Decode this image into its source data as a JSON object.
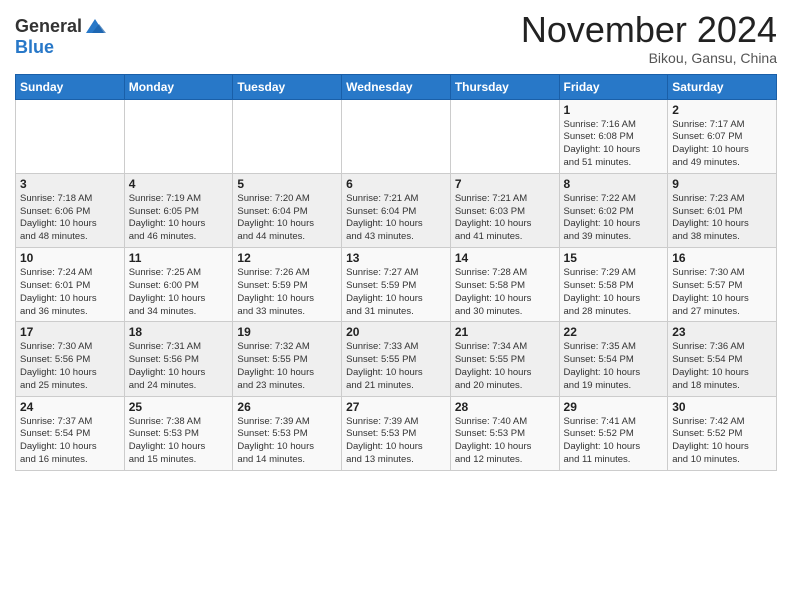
{
  "header": {
    "logo_line1": "General",
    "logo_line2": "Blue",
    "month_title": "November 2024",
    "location": "Bikou, Gansu, China"
  },
  "weekdays": [
    "Sunday",
    "Monday",
    "Tuesday",
    "Wednesday",
    "Thursday",
    "Friday",
    "Saturday"
  ],
  "weeks": [
    [
      {
        "day": "",
        "content": ""
      },
      {
        "day": "",
        "content": ""
      },
      {
        "day": "",
        "content": ""
      },
      {
        "day": "",
        "content": ""
      },
      {
        "day": "",
        "content": ""
      },
      {
        "day": "1",
        "content": "Sunrise: 7:16 AM\nSunset: 6:08 PM\nDaylight: 10 hours\nand 51 minutes."
      },
      {
        "day": "2",
        "content": "Sunrise: 7:17 AM\nSunset: 6:07 PM\nDaylight: 10 hours\nand 49 minutes."
      }
    ],
    [
      {
        "day": "3",
        "content": "Sunrise: 7:18 AM\nSunset: 6:06 PM\nDaylight: 10 hours\nand 48 minutes."
      },
      {
        "day": "4",
        "content": "Sunrise: 7:19 AM\nSunset: 6:05 PM\nDaylight: 10 hours\nand 46 minutes."
      },
      {
        "day": "5",
        "content": "Sunrise: 7:20 AM\nSunset: 6:04 PM\nDaylight: 10 hours\nand 44 minutes."
      },
      {
        "day": "6",
        "content": "Sunrise: 7:21 AM\nSunset: 6:04 PM\nDaylight: 10 hours\nand 43 minutes."
      },
      {
        "day": "7",
        "content": "Sunrise: 7:21 AM\nSunset: 6:03 PM\nDaylight: 10 hours\nand 41 minutes."
      },
      {
        "day": "8",
        "content": "Sunrise: 7:22 AM\nSunset: 6:02 PM\nDaylight: 10 hours\nand 39 minutes."
      },
      {
        "day": "9",
        "content": "Sunrise: 7:23 AM\nSunset: 6:01 PM\nDaylight: 10 hours\nand 38 minutes."
      }
    ],
    [
      {
        "day": "10",
        "content": "Sunrise: 7:24 AM\nSunset: 6:01 PM\nDaylight: 10 hours\nand 36 minutes."
      },
      {
        "day": "11",
        "content": "Sunrise: 7:25 AM\nSunset: 6:00 PM\nDaylight: 10 hours\nand 34 minutes."
      },
      {
        "day": "12",
        "content": "Sunrise: 7:26 AM\nSunset: 5:59 PM\nDaylight: 10 hours\nand 33 minutes."
      },
      {
        "day": "13",
        "content": "Sunrise: 7:27 AM\nSunset: 5:59 PM\nDaylight: 10 hours\nand 31 minutes."
      },
      {
        "day": "14",
        "content": "Sunrise: 7:28 AM\nSunset: 5:58 PM\nDaylight: 10 hours\nand 30 minutes."
      },
      {
        "day": "15",
        "content": "Sunrise: 7:29 AM\nSunset: 5:58 PM\nDaylight: 10 hours\nand 28 minutes."
      },
      {
        "day": "16",
        "content": "Sunrise: 7:30 AM\nSunset: 5:57 PM\nDaylight: 10 hours\nand 27 minutes."
      }
    ],
    [
      {
        "day": "17",
        "content": "Sunrise: 7:30 AM\nSunset: 5:56 PM\nDaylight: 10 hours\nand 25 minutes."
      },
      {
        "day": "18",
        "content": "Sunrise: 7:31 AM\nSunset: 5:56 PM\nDaylight: 10 hours\nand 24 minutes."
      },
      {
        "day": "19",
        "content": "Sunrise: 7:32 AM\nSunset: 5:55 PM\nDaylight: 10 hours\nand 23 minutes."
      },
      {
        "day": "20",
        "content": "Sunrise: 7:33 AM\nSunset: 5:55 PM\nDaylight: 10 hours\nand 21 minutes."
      },
      {
        "day": "21",
        "content": "Sunrise: 7:34 AM\nSunset: 5:55 PM\nDaylight: 10 hours\nand 20 minutes."
      },
      {
        "day": "22",
        "content": "Sunrise: 7:35 AM\nSunset: 5:54 PM\nDaylight: 10 hours\nand 19 minutes."
      },
      {
        "day": "23",
        "content": "Sunrise: 7:36 AM\nSunset: 5:54 PM\nDaylight: 10 hours\nand 18 minutes."
      }
    ],
    [
      {
        "day": "24",
        "content": "Sunrise: 7:37 AM\nSunset: 5:54 PM\nDaylight: 10 hours\nand 16 minutes."
      },
      {
        "day": "25",
        "content": "Sunrise: 7:38 AM\nSunset: 5:53 PM\nDaylight: 10 hours\nand 15 minutes."
      },
      {
        "day": "26",
        "content": "Sunrise: 7:39 AM\nSunset: 5:53 PM\nDaylight: 10 hours\nand 14 minutes."
      },
      {
        "day": "27",
        "content": "Sunrise: 7:39 AM\nSunset: 5:53 PM\nDaylight: 10 hours\nand 13 minutes."
      },
      {
        "day": "28",
        "content": "Sunrise: 7:40 AM\nSunset: 5:53 PM\nDaylight: 10 hours\nand 12 minutes."
      },
      {
        "day": "29",
        "content": "Sunrise: 7:41 AM\nSunset: 5:52 PM\nDaylight: 10 hours\nand 11 minutes."
      },
      {
        "day": "30",
        "content": "Sunrise: 7:42 AM\nSunset: 5:52 PM\nDaylight: 10 hours\nand 10 minutes."
      }
    ]
  ]
}
